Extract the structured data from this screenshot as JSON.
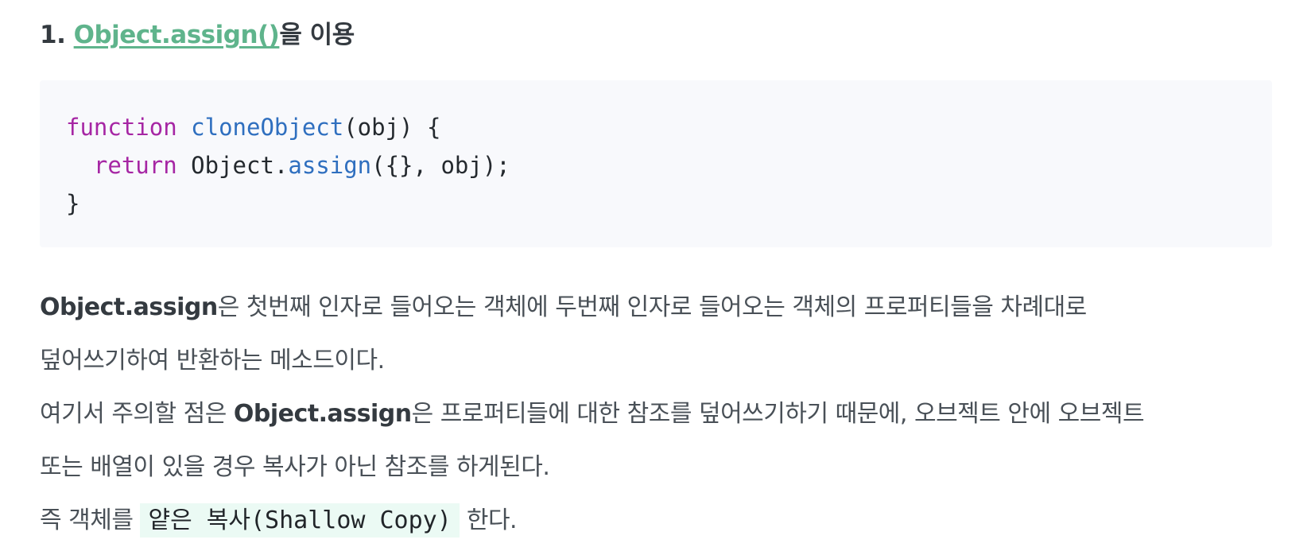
{
  "heading": {
    "number": "1. ",
    "link_text": "Object.assign()",
    "suffix": "을 이용"
  },
  "code": {
    "line1": {
      "keyword": "function",
      "name": "cloneObject",
      "rest": "(obj) {"
    },
    "line2": {
      "keyword": "return",
      "object": "Object.",
      "method": "assign",
      "rest": "({}, obj);"
    },
    "line3": "}"
  },
  "paragraph": {
    "p1": {
      "bold": "Object.assign",
      "text_a": "은 첫번째 인자로 들어오는 객체에 두번째 인자로 들어오는 객체의 프로퍼티들을 차례대로",
      "text_b": "덮어쓰기하여 반환하는 메소드이다."
    },
    "p2": {
      "pre": "여기서 주의할 점은 ",
      "bold": "Object.assign",
      "text_a": "은 프로퍼티들에 대한 참조를 덮어쓰기하기 때문에, 오브젝트 안에 오브젝트",
      "text_b": "또는 배열이 있을 경우 복사가 아닌 참조를 하게된다."
    },
    "p3": {
      "pre": "즉 객체를 ",
      "code": "얕은 복사(Shallow Copy)",
      "post": " 한다."
    }
  }
}
